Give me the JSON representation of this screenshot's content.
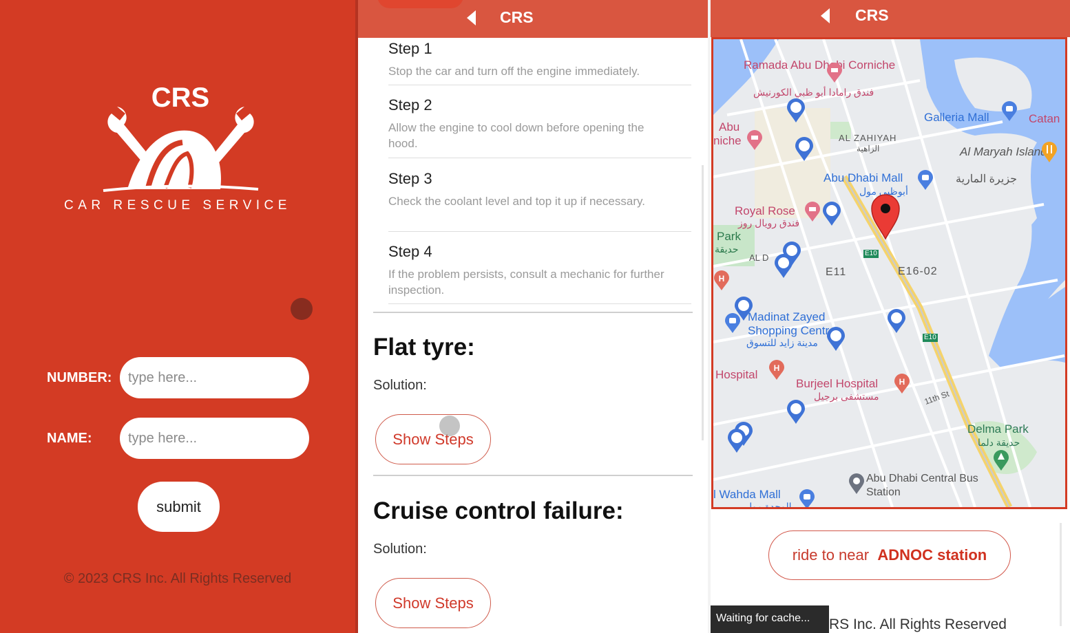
{
  "colors": {
    "brand_red": "#d33b24",
    "header_red": "#d95640",
    "white": "#ffffff"
  },
  "login": {
    "logo_text": "CRS",
    "tagline": "CAR RESCUE SERVICE",
    "number_label": "NUMBER:",
    "number_placeholder": "type here...",
    "name_label": "NAME:",
    "name_placeholder": "type here...",
    "submit_label": "submit",
    "copyright": "© 2023 CRS Inc. All Rights Reserved"
  },
  "guide": {
    "header_title": "CRS",
    "steps": [
      {
        "title": "Step 1",
        "desc": "Stop the car and turn off the engine immediately."
      },
      {
        "title": "Step 2",
        "desc": "Allow the engine to cool down before opening the hood."
      },
      {
        "title": "Step 3",
        "desc": "Check the coolant level and top it up if necessary."
      },
      {
        "title": "Step 4",
        "desc": "If the problem persists, consult a mechanic for further inspection."
      }
    ],
    "sections": [
      {
        "heading": "Flat tyre:",
        "solution_label": "Solution:",
        "button_label": "Show Steps"
      },
      {
        "heading": "Cruise control failure:",
        "solution_label": "Solution:",
        "button_label": "Show Steps"
      }
    ]
  },
  "map_screen": {
    "header_title": "CRS",
    "map_labels": {
      "ramada": "Ramada Abu Dhabi Corniche",
      "ramada_ar": "فندق رامادا أبو ظبي الكورنيش",
      "abu_corniche": "Abu",
      "abu_corniche2": "niche",
      "al_zahiyah": "AL ZAHIYAH",
      "al_zahiyah_ar": "الزاهية",
      "galleria": "Galleria Mall",
      "catan": "Catan",
      "al_maryah": "Al Maryah Island",
      "al_maryah_ar": "جزيرة المارية",
      "abu_dhabi_mall": "Abu Dhabi Mall",
      "abu_dhabi_mall_ar": "أبوظبي مول",
      "royal_rose": "Royal Rose",
      "royal_rose_ar": "فندق رويال روز",
      "park": "Park",
      "park_ar": "حديقة",
      "al_d": "AL D",
      "e11": "E11",
      "e16": "E16-02",
      "e10_a": "E10",
      "e10_b": "E10",
      "madinat": "Madinat Zayed Shopping Centre",
      "madinat_ar": "مدينة زايد للتسوق",
      "hospital": "Hospital",
      "burjeel": "Burjeel Hospital",
      "burjeel_ar": "مستشفى برجيل",
      "eleventh": "11th St",
      "delma": "Delma Park",
      "delma_ar": "حديقة دلما",
      "bus_station": "Abu Dhabi Central Bus Station",
      "wahda": "l Wahda Mall",
      "wahda_ar": "الوحدة مول"
    },
    "ride_label": "ride to near",
    "ride_target": "ADNOC station",
    "status_toast": "Waiting for cache...",
    "copyright_partial": "RS Inc. All Rights Reserved"
  }
}
